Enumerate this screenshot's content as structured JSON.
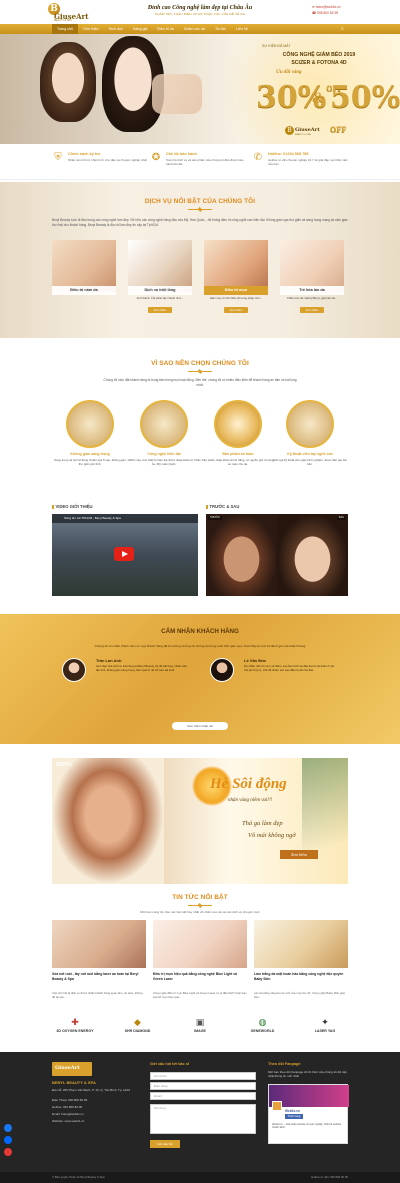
{
  "header": {
    "logo_name": "GiuseArt",
    "logo_sub": "BEAUTY & SPA",
    "slogan_main": "Đỉnh cao Công nghệ làm đẹp tại Châu Âu",
    "slogan_sub": "CHĂM SÓC TOÀN DIỆN VÀ AN TOÀN CÁC VẤN ĐỀ VỀ DA",
    "email": "hotro@web2s.vn",
    "phone": "098 800 82 95"
  },
  "nav": {
    "items": [
      "Trang chủ",
      "Giới thiệu",
      "Hình ảnh",
      "Bảng giá",
      "Điều trị da",
      "Chăm sóc da",
      "Tin tức",
      "Liên hệ"
    ],
    "search_icon": "search-icon"
  },
  "hero": {
    "event": "SỰ KIỆN ĐÃ MẮT",
    "title1": "CÔNG NGHỆ GIẢM BÉO 2019",
    "title2": "SCIZER & FOTONA 4D",
    "offer": "Ưu đãi vàng",
    "pct1": "30%",
    "pct2": "50%",
    "off": "OFF",
    "amp": "&",
    "logo_name": "GiuseArt",
    "logo_sub": "BEAUTY & SPA"
  },
  "features": [
    {
      "icon": "shield-icon",
      "title": "Chính sách kỳ trợ",
      "desc": "Nhân viên hỗ trợ nhiệt tình, chu đáo và chuyên nghiệp nhất"
    },
    {
      "icon": "medal-icon",
      "title": "Chế độ bảo hành",
      "desc": "Toàn bộ dịch vụ và sản phẩm của chúng tôi đều được bảo hành lâu dài"
    },
    {
      "icon": "phone-icon",
      "title": "Hotline: 01234 568 789",
      "desc": "Hotline tư vấn chuyên nghiệp 24.7 sẽ giải đáp mọi thắc mắc của bạn"
    }
  ],
  "services": {
    "title": "DỊCH VỤ NỔI BẬT CỦA CHÚNG TÔI",
    "intro": "Beryl Beauty luôn đi đầu trong các công nghệ làm đẹp. Sở hữu các công nghệ hàng đầu của Mỹ, Hàn Quốc,...hệ thống điều trị công nghệ cao hiện đại. Không gian spa thư giãn và sang trọng mang lại cảm giác thư thái cho khách hàng. Beryl Beauty là địa chỉ làm đẹp tin cậy tại TpHCM.",
    "cards": [
      {
        "label": "Điều trị nám da",
        "desc": "",
        "btn": ""
      },
      {
        "label": "Dịch vụ triệt lông",
        "desc": "Anh thánh, tỉ lệ phân lây nhanh như...",
        "btn": "Xem thêm"
      },
      {
        "label": "Điều trị mụn",
        "desc": "Hiện nay có rất nhiều phương pháp như...",
        "btn": "Xem thêm"
      },
      {
        "label": "Trẻ hóa làn da",
        "desc": "Chăm sóc da mặt tại Beryl, giúp làn da...",
        "btn": "Xem thêm"
      }
    ]
  },
  "why": {
    "title": "VÌ SAO NÊN CHỌN CHÚNG TÔI",
    "intro": "Chúng tôi luôn đặt khách hàng là trung tâm trong mọi hoạt động. Bên thế, chúng tôi có nhiều điều kiện để khách hàng an tâm và hài lòng nhất.",
    "items": [
      {
        "title": "Không gian sang trọng",
        "desc": "Sang trọng và tinh tế đúng chuẩn spa 5 sao, không gian thư giãn yên tĩnh."
      },
      {
        "title": "Công nghệ hiện đại",
        "desc": "100% máy móc thiết bị hiện đại được nhập khẩu từ Châu Âu, Mỹ, Hàn Quốc."
      },
      {
        "title": "Bàn phẩm an toàn",
        "desc": "Sản phẩm nhập khẩu chính hãng, có nguồn gốc rõ ràng, an toàn cho da."
      },
      {
        "title": "Kỹ thuật viên tay nghề cao",
        "desc": "Đội ngũ kỹ thuật viên giàu kinh nghiệm, được đào tạo bài bản."
      }
    ]
  },
  "video": {
    "heading": "VIDEO GIỚI THIỆU",
    "video_title": "Sông tìm sôi TPHCM - Beryl Beauty & Spa",
    "ba_heading": "TRƯỚC & SAU",
    "before": "TRƯỚC",
    "after": "SAU"
  },
  "testimonials": {
    "title": "CẢM NHẬN KHÁCH HÀNG",
    "intro": "Chúng tôi xin chân thành cảm ơn quý khách hàng đã tin tưởng và ủng hộ chúng tôi trong suốt thời gian qua. Dưới đây là một số đánh giá của khách hàng",
    "items": [
      {
        "name": "Trần Lan Anh",
        "text": "Làm đẹp vừa dịch vụ triệt lông tại Beryl Beauty, tôi rất hài lòng. Nhân viên tận tình, không gian sang trọng, hiệu quả rõ rệt chỉ sau vài buổi."
      },
      {
        "name": "Lê Văn Đức",
        "text": "Da nhiều năm bị mụn và thâm, sau liệu trình tại đây da tôi cải thiện rõ rệt. Chi phí hợp lý, chế độ chăm sóc sau điều trị rất chu đáo."
      }
    ],
    "more": "Xem thêm nhận xét"
  },
  "promo": {
    "brand": "BERYL",
    "h1": "Hè Sôi động",
    "h2": "nhận vàng niềm vui!!!",
    "h3": "Thả ga làm đẹp",
    "h4": "Vô mái không ngờ",
    "btn": "Xem thêm"
  },
  "news": {
    "title": "TIN TỨC NỔI BẬT",
    "intro": "Mời bạn cùng tìm đọc các bài viết hay nhất về chăm sóc da và các dịch vụ chuyên môn",
    "items": [
      {
        "title": "Xóa nốt ruồi - tây nốt ruồi bằng laser an toàn tại Beryl Beauty & Spa",
        "desc": "Xóa nốt ruồi là dịch vụ được nhiều khách hàng quan tâm, an toàn, không để lại sẹo..."
      },
      {
        "title": "Điều trị mụn hiệu quả bằng công nghệ Blue Light và Green Laser",
        "desc": "Công nghệ điều trị mụn Blue Light và Green Laser có gì đặc biệt? Giúp bạn loại bỏ mụn hiệu quả..."
      },
      {
        "title": "Làm trắng da mặt hoàn hảo bằng công nghệ độc quyền Baby Skin",
        "desc": "Làn da trắng sáng là mơ ước của mọi phụ nữ. Công nghệ Baby Skin giúp bạn..."
      }
    ]
  },
  "partners": [
    {
      "icon": "plus-icon",
      "name": "3D OXYGEN ENERGY"
    },
    {
      "icon": "shr-icon",
      "name": "SHR DIAMOND"
    },
    {
      "icon": "image-icon",
      "name": "IMAGE"
    },
    {
      "icon": "globe-icon",
      "name": "GENEWORLD"
    },
    {
      "icon": "laser-icon",
      "name": "LASER YAG"
    }
  ],
  "footer": {
    "logo": "GiuseArt",
    "company": "BERYL BEAUTY & SPA",
    "address": "Địa chỉ: 295 Phạm Văn Bạch, P. 15, Q. Tân Bình, Tp. HCM",
    "phone": "Điện Thoại: 096.800.82.95",
    "hotline": "Hotline: 094.800.82.95",
    "email": "Email: hotro@web2s.vn",
    "website": "Website: www.web2s.vn",
    "form_title": "Gửi câu hỏi tới bác sĩ",
    "form_name": "Họ và tên",
    "form_phone": "Điện thoại",
    "form_email": "Email",
    "form_msg": "Nội dung",
    "form_send": "Gửi câu hỏi",
    "fb_title": "Theo dõi Fanpage",
    "fb_desc": "Mời bạn theo dõi Fanpage chính thức của chúng tôi để cập nhật thông tin mới nhất",
    "fb_page": "Web2s.vn",
    "fb_like": "Thích trang",
    "fb_post": "Web2s.vn – Giải pháp website chuyên nghiệp, thiết kế website chuẩn SEO."
  },
  "copyright": {
    "left": "© Bản quyền thuộc về Beryl Beauty & Spa",
    "right": "Hotline tư vấn: 096 800 82 95"
  }
}
